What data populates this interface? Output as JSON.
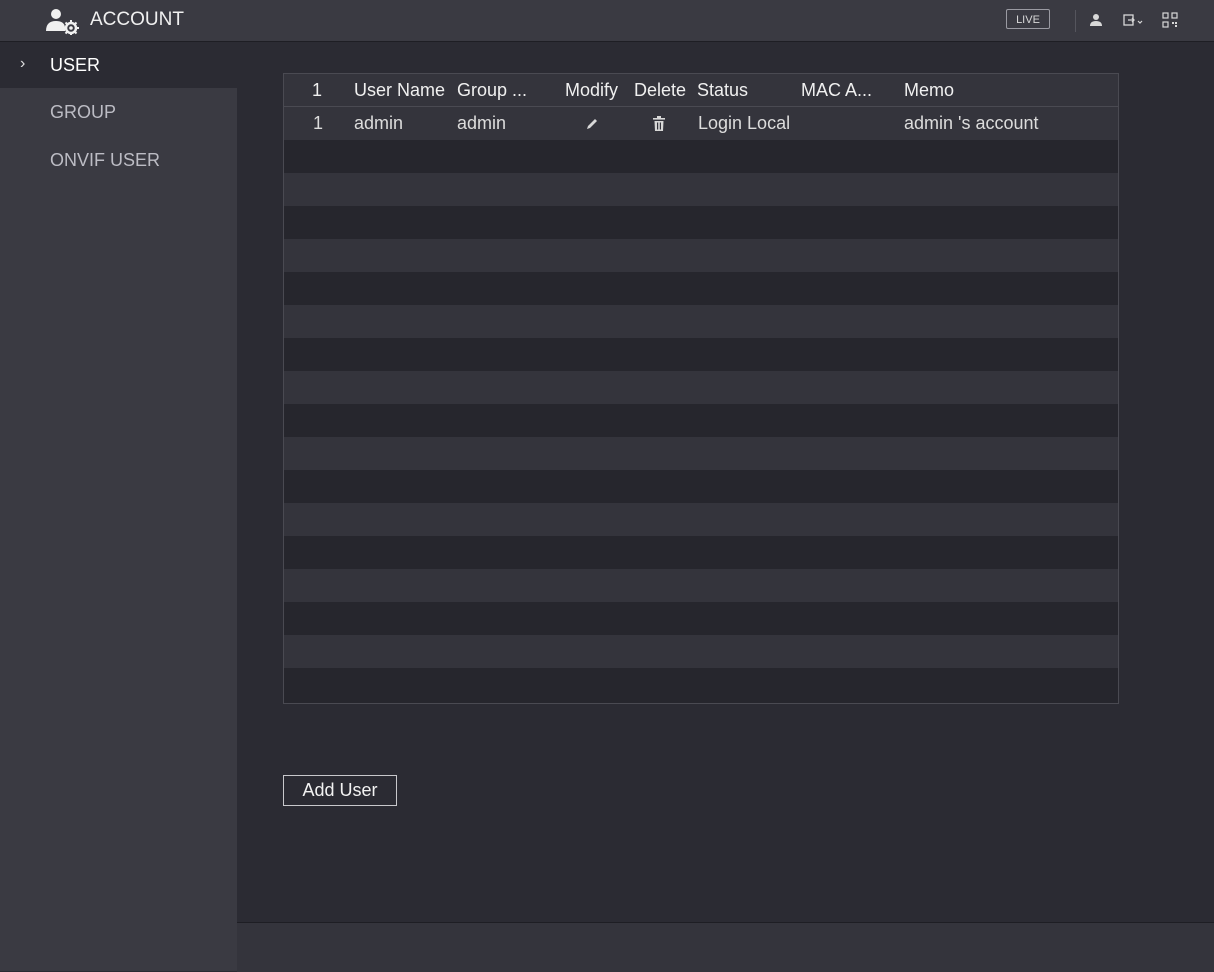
{
  "header": {
    "title": "ACCOUNT",
    "live_label": "LIVE",
    "icons": [
      "account-settings-icon",
      "user-icon",
      "logout-icon",
      "qr-code-icon"
    ]
  },
  "sidebar": {
    "items": [
      {
        "label": "USER",
        "active": true
      },
      {
        "label": "GROUP",
        "active": false
      },
      {
        "label": "ONVIF USER",
        "active": false
      }
    ]
  },
  "table": {
    "columns": [
      "1",
      "User Name",
      "Group ...",
      "Modify",
      "Delete",
      "Status",
      "MAC A...",
      "Memo"
    ],
    "rows": [
      {
        "index": "1",
        "user_name": "admin",
        "group": "admin",
        "modify_icon": "pencil-icon",
        "delete_icon": "trash-icon",
        "status": "Login Local",
        "mac": "",
        "memo": "admin 's account"
      }
    ]
  },
  "actions": {
    "add_user_label": "Add User"
  },
  "colors": {
    "background": "#2b2b33",
    "panel": "#3a3a42",
    "text": "#e6e6e6"
  }
}
